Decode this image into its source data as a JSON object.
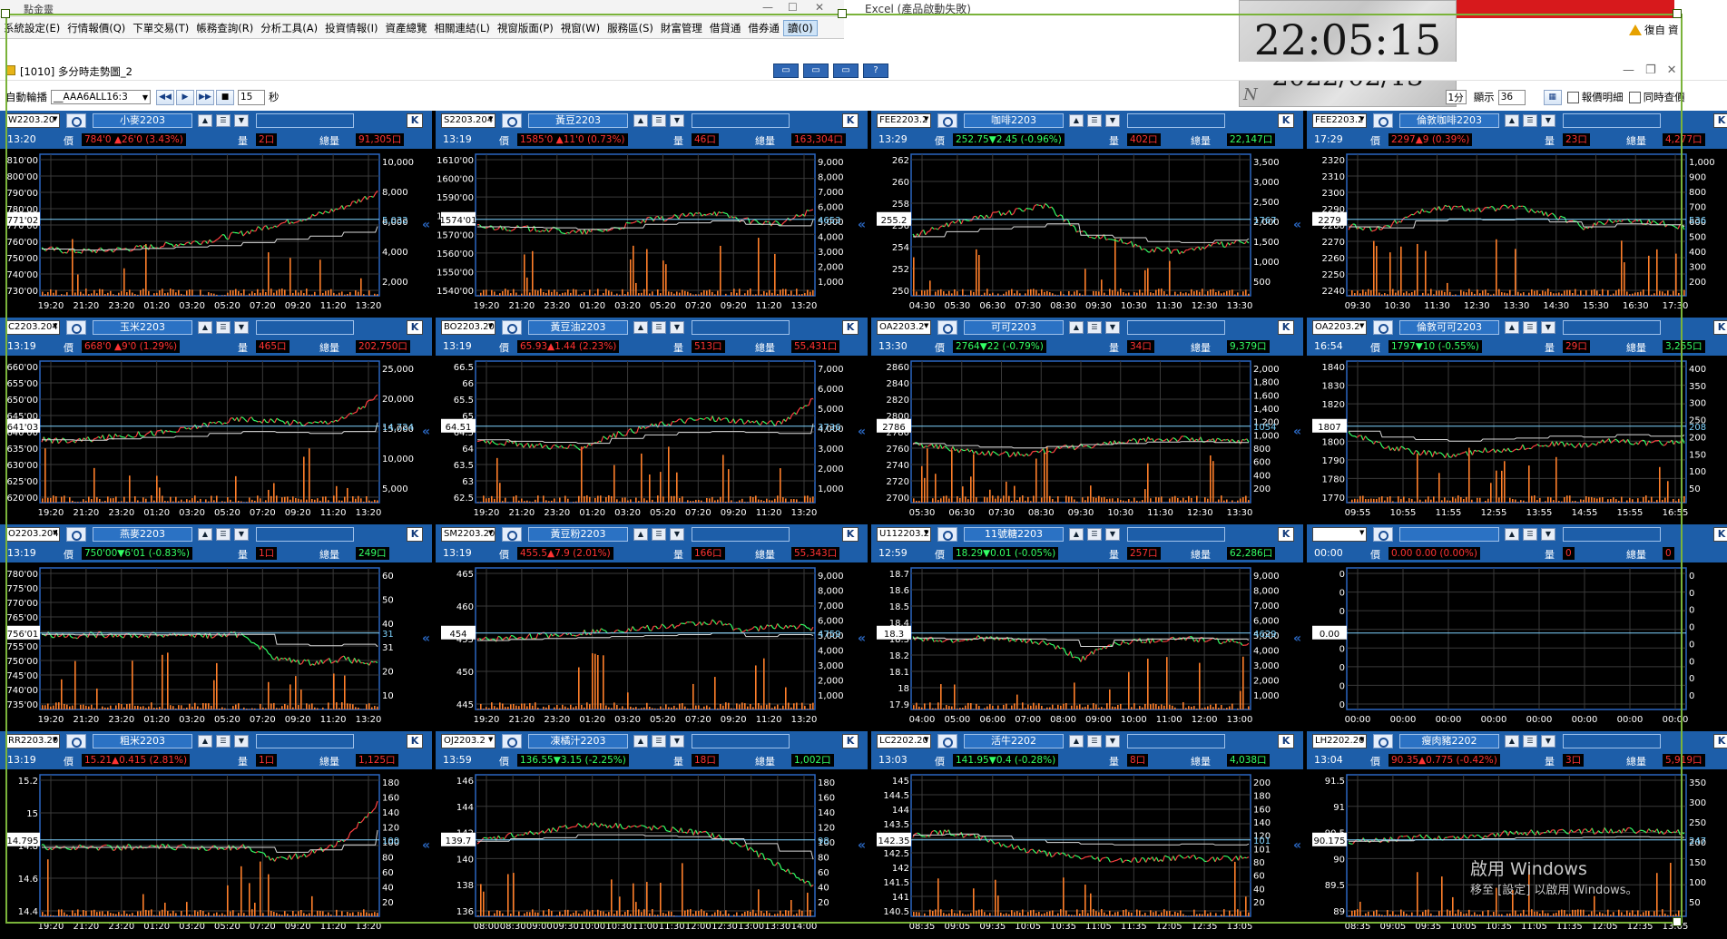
{
  "main_window": {
    "title": "點金靈"
  },
  "menu": [
    "系統設定(E)",
    "行情報價(Q)",
    "下單交易(T)",
    "帳務查詢(R)",
    "分析工具(A)",
    "投資情報(I)",
    "資產總覽",
    "相關連結(L)",
    "視窗版面(P)",
    "視窗(W)",
    "服務區(S)",
    "財富管理",
    "借貸通",
    "借券通",
    "讀(0)"
  ],
  "excel_title": "Excel (產品啟動失敗)",
  "right_tools": {
    "label": "復自",
    "item2": "資"
  },
  "clock": {
    "time": "22:05:15",
    "date": "2022/02/13",
    "logo": "N"
  },
  "subwindow": {
    "title": "[1010] 多分時走勢圖_2"
  },
  "toolbar": {
    "auto_label": "自動輪播",
    "combo_value": "__AAA6ALL16:3",
    "interval": "15",
    "seconds": "秒",
    "period": "1分",
    "show_label": "顯示",
    "show_count": "36",
    "detail_label": "報價明細",
    "sync_label": "同時查價"
  },
  "colors": {
    "up": "#ff3333",
    "down": "#33ff66",
    "axis_blue": "#2a66bf",
    "header_blue": "#1d5ea9"
  },
  "overlay": {
    "line1": "啟用 Windows",
    "line2": "移至 [設定] 以啟用 Windows。"
  },
  "panels": [
    {
      "sym": "W2203.20",
      "name": "小麥2203",
      "time": "13:20",
      "price": "784'0 ▲26'0 (3.43%)",
      "dir": "up",
      "qty": "2口",
      "total": "91,305口",
      "cur": "771'02",
      "ylab": [
        "810'00",
        "800'00",
        "790'00",
        "780'00",
        "770'00",
        "760'00",
        "750'00",
        "740'00",
        "730'00"
      ],
      "vlab": [
        "10,000",
        "8,000",
        "6,000",
        "4,000",
        "2,000"
      ],
      "vright": "5,032",
      "xlab": [
        "19:20",
        "21:20",
        "23:20",
        "01:20",
        "03:20",
        "05:20",
        "07:20",
        "09:20",
        "11:20",
        "13:20"
      ],
      "series": [
        0.32,
        0.3,
        0.31,
        0.33,
        0.36,
        0.39,
        0.45,
        0.52,
        0.58,
        0.66,
        0.78
      ]
    },
    {
      "sym": "S2203.204",
      "name": "黃豆2203",
      "time": "13:19",
      "price": "1585'0 ▲11'0 (0.73%)",
      "dir": "up",
      "qty": "46口",
      "total": "163,304口",
      "cur": "1574'01",
      "ylab": [
        "1610'00",
        "1600'00",
        "1590'00",
        "1580'00",
        "1570'00",
        "1560'00",
        "1550'00",
        "1540'00"
      ],
      "vlab": [
        "9,000",
        "8,000",
        "7,000",
        "6,000",
        "5,000",
        "4,000",
        "3,000",
        "2,000",
        "1,000"
      ],
      "vright": "4653",
      "xlab": [
        "19:20",
        "21:20",
        "23:20",
        "01:20",
        "03:20",
        "05:20",
        "07:20",
        "09:20",
        "11:20",
        "13:20"
      ],
      "series": [
        0.5,
        0.49,
        0.48,
        0.45,
        0.48,
        0.55,
        0.58,
        0.62,
        0.55,
        0.52,
        0.64
      ]
    },
    {
      "sym": "FEE2203.2",
      "name": "咖啡2203",
      "time": "13:29",
      "price": "252.75▼2.45 (-0.96%)",
      "dir": "dn",
      "qty": "402口",
      "total": "22,147口",
      "cur": "255.2",
      "ylab": [
        "262",
        "260",
        "258",
        "256",
        "254",
        "252",
        "250"
      ],
      "vlab": [
        "3,500",
        "3,000",
        "2,500",
        "2,000",
        "1,500",
        "1,000",
        "500"
      ],
      "vright": "1767",
      "xlab": [
        "04:30",
        "05:30",
        "06:30",
        "07:30",
        "08:30",
        "09:30",
        "10:30",
        "11:30",
        "12:30",
        "13:30"
      ],
      "series": [
        0.42,
        0.52,
        0.58,
        0.62,
        0.68,
        0.45,
        0.4,
        0.32,
        0.3,
        0.35,
        0.38
      ]
    },
    {
      "sym": "FEE2203.2",
      "name": "倫敦咖啡2203",
      "time": "17:29",
      "price": "2297▲9 (0.39%)",
      "dir": "up",
      "qty": "23口",
      "total": "4,277口",
      "cur": "2279",
      "ylab": [
        "2320",
        "2310",
        "2300",
        "2290",
        "2280",
        "2270",
        "2260",
        "2250",
        "2240"
      ],
      "vlab": [
        "1,000",
        "900",
        "800",
        "700",
        "600",
        "500",
        "400",
        "300",
        "200"
      ],
      "vright": "536",
      "xlab": [
        "09:30",
        "10:30",
        "11:30",
        "12:30",
        "13:30",
        "14:30",
        "15:30",
        "16:30",
        "17:30"
      ],
      "series": [
        0.5,
        0.48,
        0.62,
        0.66,
        0.64,
        0.66,
        0.6,
        0.5,
        0.56,
        0.54,
        0.5
      ]
    },
    {
      "sym": "C2203.204",
      "name": "玉米2203",
      "time": "13:19",
      "price": "668'0 ▲9'0 (1.29%)",
      "dir": "up",
      "qty": "465口",
      "total": "202,750口",
      "cur": "641'03",
      "ylab": [
        "660'00",
        "655'00",
        "650'00",
        "645'00",
        "640'00",
        "635'00",
        "630'00",
        "625'00",
        "620'00"
      ],
      "vlab": [
        "25,000",
        "20,000",
        "15,000",
        "10,000",
        "5,000"
      ],
      "vright": "14,724",
      "xlab": [
        "19:20",
        "21:20",
        "23:20",
        "01:20",
        "03:20",
        "05:20",
        "07:20",
        "09:20",
        "11:20",
        "13:20"
      ],
      "series": [
        0.45,
        0.44,
        0.47,
        0.5,
        0.52,
        0.58,
        0.62,
        0.6,
        0.58,
        0.62,
        0.8
      ]
    },
    {
      "sym": "BO2203.20",
      "name": "黃豆油2203",
      "time": "13:19",
      "price": "65.93▲1.44 (2.23%)",
      "dir": "up",
      "qty": "513口",
      "total": "55,431口",
      "cur": "64.51",
      "ylab": [
        "66.5",
        "66",
        "65.5",
        "65",
        "64.5",
        "64",
        "63.5",
        "63",
        "62.5"
      ],
      "vlab": [
        "7,000",
        "6,000",
        "5,000",
        "4,000",
        "3,000",
        "2,000",
        "1,000"
      ],
      "vright": "3736",
      "xlab": [
        "19:20",
        "21:20",
        "23:20",
        "01:20",
        "03:20",
        "05:20",
        "07:20",
        "09:20",
        "11:20",
        "13:20"
      ],
      "series": [
        0.45,
        0.42,
        0.4,
        0.38,
        0.48,
        0.55,
        0.6,
        0.62,
        0.6,
        0.58,
        0.78
      ]
    },
    {
      "sym": "OA2203.2",
      "name": "可可2203",
      "time": "13:30",
      "price": "2764▼22 (-0.79%)",
      "dir": "dn",
      "qty": "34口",
      "total": "9,379口",
      "cur": "2786",
      "ylab": [
        "2860",
        "2840",
        "2820",
        "2800",
        "2780",
        "2760",
        "2740",
        "2720",
        "2700"
      ],
      "vlab": [
        "2,000",
        "1,800",
        "1,600",
        "1,400",
        "1,200",
        "1,000",
        "800",
        "600",
        "400",
        "200"
      ],
      "vright": "1054",
      "xlab": [
        "05:30",
        "06:30",
        "07:30",
        "08:30",
        "09:30",
        "10:30",
        "11:30",
        "12:30",
        "13:30"
      ],
      "series": [
        0.42,
        0.38,
        0.35,
        0.33,
        0.36,
        0.4,
        0.42,
        0.45,
        0.46,
        0.44,
        0.44
      ]
    },
    {
      "sym": "OA2203.2",
      "name": "倫敦可可2203",
      "time": "16:54",
      "price": "1797▼10 (-0.55%)",
      "dir": "dn",
      "qty": "29口",
      "total": "3,255口",
      "cur": "1807",
      "ylab": [
        "1840",
        "1830",
        "1820",
        "1810",
        "1800",
        "1790",
        "1780",
        "1770"
      ],
      "vlab": [
        "400",
        "350",
        "300",
        "250",
        "200",
        "150",
        "100",
        "50"
      ],
      "vright": "208",
      "xlab": [
        "09:55",
        "10:55",
        "11:55",
        "12:55",
        "13:55",
        "14:55",
        "15:55",
        "16:55"
      ],
      "series": [
        0.52,
        0.4,
        0.35,
        0.32,
        0.36,
        0.38,
        0.42,
        0.4,
        0.45,
        0.42,
        0.44
      ]
    },
    {
      "sym": "O2203.204",
      "name": "燕麥2203",
      "time": "13:19",
      "price": "750'00▼6'01 (-0.83%)",
      "dir": "dn",
      "qty": "1口",
      "total": "249口",
      "cur": "756'01",
      "ylab": [
        "780'00",
        "775'00",
        "770'00",
        "765'00",
        "760'00",
        "755'00",
        "750'00",
        "745'00",
        "740'00",
        "735'00"
      ],
      "vlab": [
        "60",
        "50",
        "40",
        "31",
        "20",
        "10"
      ],
      "vright": "31",
      "xlab": [
        "19:20",
        "21:20",
        "23:20",
        "01:20",
        "03:20",
        "05:20",
        "07:20",
        "09:20",
        "11:20",
        "13:20"
      ],
      "series": [
        0.55,
        0.54,
        0.55,
        0.54,
        0.55,
        0.54,
        0.55,
        0.35,
        0.32,
        0.35,
        0.3
      ]
    },
    {
      "sym": "SM2203.20",
      "name": "黃豆粉2203",
      "time": "13:19",
      "price": "455.5▲7.9 (2.01%)",
      "dir": "up",
      "qty": "166口",
      "total": "55,343口",
      "cur": "454",
      "ylab": [
        "465",
        "460",
        "455",
        "450",
        "445"
      ],
      "vlab": [
        "9,000",
        "8,000",
        "7,000",
        "6,000",
        "5,000",
        "4,000",
        "3,000",
        "2,000",
        "1,000"
      ],
      "vright": "4759",
      "xlab": [
        "19:20",
        "21:20",
        "23:20",
        "01:20",
        "03:20",
        "05:20",
        "07:20",
        "09:20",
        "11:20",
        "13:20"
      ],
      "series": [
        0.5,
        0.52,
        0.54,
        0.56,
        0.58,
        0.6,
        0.62,
        0.65,
        0.58,
        0.62,
        0.6
      ]
    },
    {
      "sym": "U112203.2",
      "name": "11號糖2203",
      "time": "12:59",
      "price": "18.29▼0.01 (-0.05%)",
      "dir": "dn",
      "qty": "257口",
      "total": "62,286口",
      "cur": "18.3",
      "ylab": [
        "18.7",
        "18.6",
        "18.5",
        "18.4",
        "18.3",
        "18.2",
        "18.1",
        "18",
        "17.9"
      ],
      "vlab": [
        "9,000",
        "8,000",
        "7,000",
        "6,000",
        "5,000",
        "4,000",
        "3,000",
        "2,000",
        "1,000"
      ],
      "vright": "4629",
      "xlab": [
        "04:00",
        "05:00",
        "06:00",
        "07:00",
        "08:00",
        "09:00",
        "10:00",
        "11:00",
        "12:00",
        "13:00"
      ],
      "series": [
        0.52,
        0.5,
        0.52,
        0.5,
        0.48,
        0.35,
        0.48,
        0.5,
        0.52,
        0.5,
        0.48
      ]
    },
    {
      "sym": "",
      "name": "",
      "time": "00:00",
      "price": "0.00 0.00 (0.00%)",
      "dir": "nt",
      "qty": "0",
      "total": "0",
      "cur": "0.00",
      "ylab": [
        "0",
        "0",
        "0",
        "0",
        "0",
        "0",
        "0",
        "0"
      ],
      "vlab": [
        "0",
        "0",
        "0",
        "0",
        "0",
        "0",
        "0",
        "0"
      ],
      "vright": "",
      "xlab": [
        "00:00",
        "00:00",
        "00:00",
        "00:00",
        "00:00",
        "00:00",
        "00:00",
        "00:00"
      ],
      "series": []
    },
    {
      "sym": "RR2203.20",
      "name": "粗米2203",
      "time": "13:19",
      "price": "15.21▲0.415 (2.81%)",
      "dir": "up",
      "qty": "1口",
      "total": "1,125口",
      "cur": "14.795",
      "ylab": [
        "15.2",
        "15",
        "14.8",
        "14.6",
        "14.4"
      ],
      "vlab": [
        "180",
        "160",
        "140",
        "120",
        "100",
        "80",
        "60",
        "40",
        "20"
      ],
      "vright": "100",
      "xlab": [
        "19:20",
        "21:20",
        "23:20",
        "01:20",
        "03:20",
        "05:20",
        "07:20",
        "09:20",
        "11:20",
        "13:20"
      ],
      "series": [
        0.5,
        0.5,
        0.5,
        0.5,
        0.5,
        0.5,
        0.5,
        0.4,
        0.45,
        0.55,
        0.85
      ]
    },
    {
      "sym": "OJ2203.2",
      "name": "凍橘汁2203",
      "time": "13:59",
      "price": "136.55▼3.15 (-2.25%)",
      "dir": "dn",
      "qty": "18口",
      "total": "1,002口",
      "cur": "139.7",
      "ylab": [
        "146",
        "144",
        "142",
        "140",
        "138",
        "136"
      ],
      "vlab": [
        "180",
        "160",
        "140",
        "120",
        "100",
        "80",
        "60",
        "40",
        "20"
      ],
      "vright": "98",
      "xlab": [
        "08:00",
        "08:30",
        "09:00",
        "09:30",
        "10:00",
        "10:30",
        "11:00",
        "11:30",
        "12:00",
        "12:30",
        "13:00",
        "13:30",
        "14:00"
      ],
      "series": [
        0.55,
        0.6,
        0.62,
        0.68,
        0.68,
        0.66,
        0.64,
        0.6,
        0.5,
        0.35,
        0.18
      ]
    },
    {
      "sym": "LC2202.20",
      "name": "活牛2202",
      "time": "13:03",
      "price": "141.95▼0.4 (-0.28%)",
      "dir": "dn",
      "qty": "8口",
      "total": "4,038口",
      "cur": "142.35",
      "ylab": [
        "145",
        "144.5",
        "144",
        "143.5",
        "143",
        "142.5",
        "142",
        "141.5",
        "141",
        "140.5"
      ],
      "vlab": [
        "200",
        "180",
        "160",
        "140",
        "120",
        "101",
        "80",
        "60",
        "40",
        "20"
      ],
      "vright": "101",
      "xlab": [
        "08:35",
        "09:05",
        "09:35",
        "10:05",
        "10:35",
        "11:05",
        "11:35",
        "12:05",
        "12:35",
        "13:05"
      ],
      "series": [
        0.6,
        0.62,
        0.58,
        0.5,
        0.45,
        0.42,
        0.4,
        0.4,
        0.42,
        0.4,
        0.42
      ]
    },
    {
      "sym": "LH2202.20",
      "name": "瘦肉豬2202",
      "time": "13:04",
      "price": "90.35▲0.775 (-0.42%)",
      "dir": "up",
      "qty": "3口",
      "total": "5,919口",
      "cur": "90.175",
      "ylab": [
        "91.5",
        "91",
        "90.5",
        "90",
        "89.5",
        "89"
      ],
      "vlab": [
        "350",
        "300",
        "250",
        "200",
        "150",
        "100",
        "50"
      ],
      "vright": "247",
      "xlab": [
        "08:35",
        "09:05",
        "09:35",
        "10:05",
        "10:35",
        "11:05",
        "11:35",
        "12:05",
        "12:35",
        "13:05"
      ],
      "series": [
        0.55,
        0.56,
        0.58,
        0.58,
        0.6,
        0.62,
        0.62,
        0.63,
        0.64,
        0.63,
        0.62
      ]
    }
  ],
  "panel_labels": {
    "price": "價",
    "qty": "量",
    "total": "總量",
    "kbtn": "K",
    "chev": "«"
  }
}
